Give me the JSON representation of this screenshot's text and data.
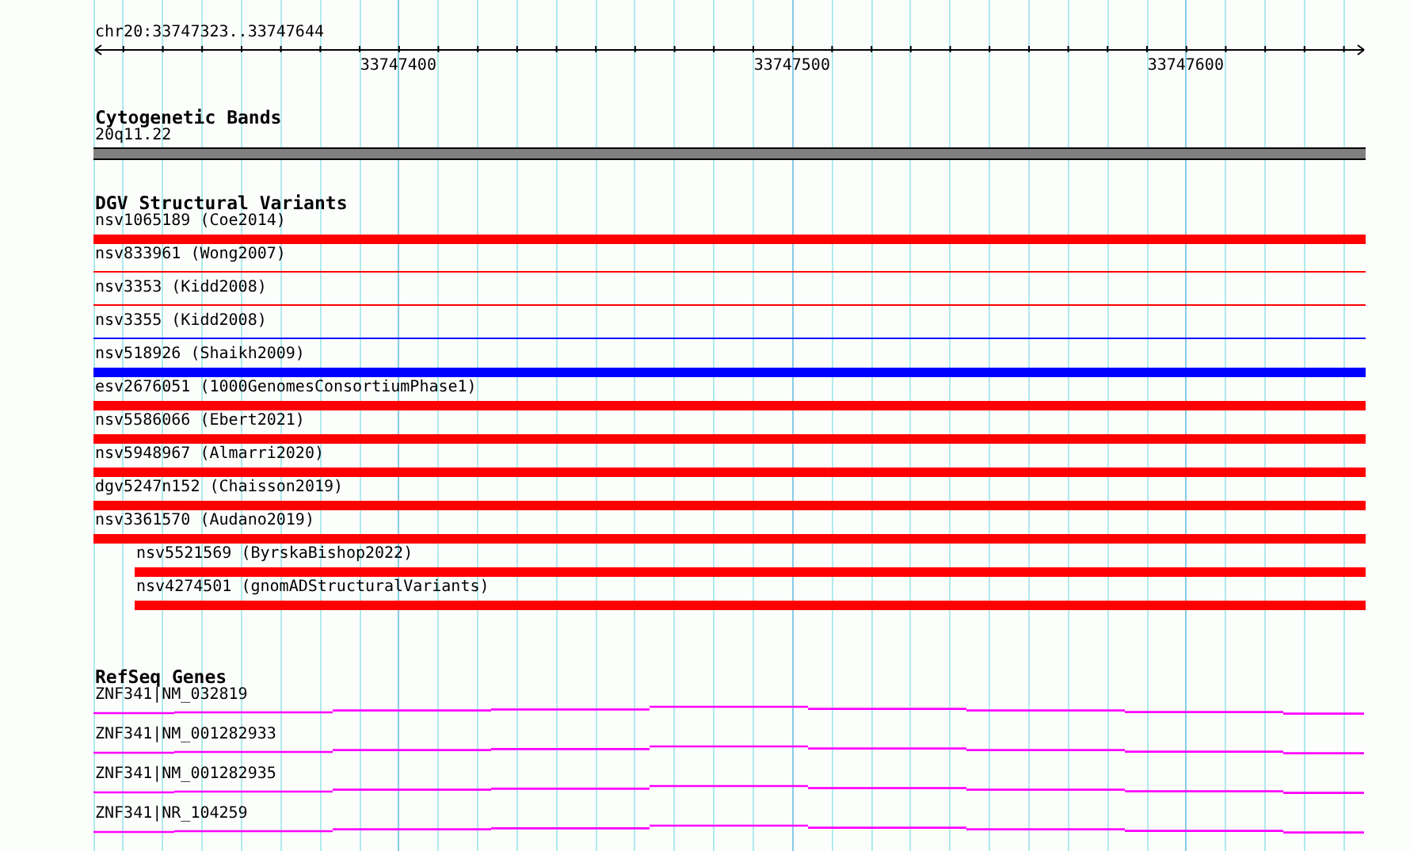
{
  "ruler": {
    "region": "chr20:33747323..33747644",
    "tick_labels": [
      "33747400",
      "33747500",
      "33747600"
    ]
  },
  "tracks": [
    {
      "kind": "bands",
      "title": "Cytogenetic Bands",
      "features": [
        {
          "label": "20q11.22"
        }
      ]
    },
    {
      "kind": "variants",
      "title": "DGV Structural Variants",
      "features": [
        {
          "label": "nsv1065189 (Coe2014)",
          "kind": "thick",
          "color": "#ff0000",
          "inset": false
        },
        {
          "label": "nsv833961 (Wong2007)",
          "kind": "thin",
          "color": "#ff0000",
          "inset": false
        },
        {
          "label": "nsv3353 (Kidd2008)",
          "kind": "thin",
          "color": "#ff0000",
          "inset": false
        },
        {
          "label": "nsv3355 (Kidd2008)",
          "kind": "thin",
          "color": "#0000ff",
          "inset": false
        },
        {
          "label": "nsv518926 (Shaikh2009)",
          "kind": "thick",
          "color": "#0000ff",
          "inset": false
        },
        {
          "label": "esv2676051 (1000GenomesConsortiumPhase1)",
          "kind": "thick",
          "color": "#ff0000",
          "inset": false
        },
        {
          "label": "nsv5586066 (Ebert2021)",
          "kind": "thick",
          "color": "#ff0000",
          "inset": false
        },
        {
          "label": "nsv5948967 (Almarri2020)",
          "kind": "thick",
          "color": "#ff0000",
          "inset": false
        },
        {
          "label": "dgv5247n152 (Chaisson2019)",
          "kind": "thick",
          "color": "#ff0000",
          "inset": false
        },
        {
          "label": "nsv3361570 (Audano2019)",
          "kind": "thick",
          "color": "#ff0000",
          "inset": false
        },
        {
          "label": "nsv5521569 (ByrskaBishop2022)",
          "kind": "thick",
          "color": "#ff0000",
          "inset": true
        },
        {
          "label": "nsv4274501 (gnomADStructuralVariants)",
          "kind": "thick",
          "color": "#ff0000",
          "inset": true
        }
      ]
    },
    {
      "kind": "genes",
      "title": "RefSeq Genes",
      "features": [
        {
          "label": "ZNF341|NM_032819"
        },
        {
          "label": "ZNF341|NM_001282933"
        },
        {
          "label": "ZNF341|NM_001282935"
        },
        {
          "label": "ZNF341|NR_104259"
        }
      ]
    }
  ]
}
